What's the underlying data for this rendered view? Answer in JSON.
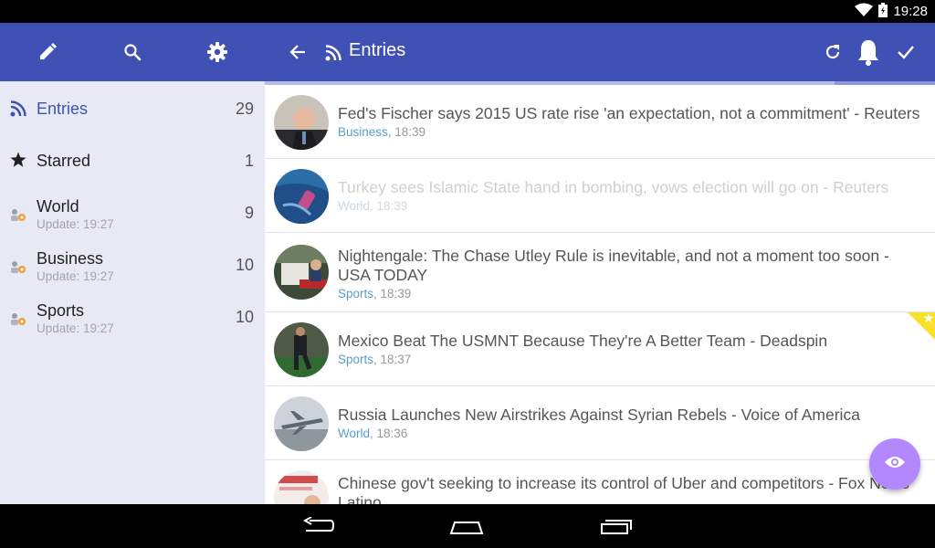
{
  "status_bar": {
    "time": "19:28"
  },
  "sidebar": {
    "toolbar_icons": [
      "edit-icon",
      "search-icon",
      "settings-icon"
    ],
    "items": [
      {
        "name": "Entries",
        "count": "29",
        "sub": "",
        "icon": "rss-icon"
      },
      {
        "name": "Starred",
        "count": "1",
        "sub": "",
        "icon": "star-icon"
      },
      {
        "name": "World",
        "count": "9",
        "sub": "Update: 19:27",
        "icon": "feed-icon"
      },
      {
        "name": "Business",
        "count": "10",
        "sub": "Update: 19:27",
        "icon": "feed-icon"
      },
      {
        "name": "Sports",
        "count": "10",
        "sub": "Update: 19:27",
        "icon": "feed-icon"
      }
    ]
  },
  "toolbar": {
    "title": "Entries",
    "icons": [
      "back-arrow-icon",
      "rss-icon",
      "refresh-icon",
      "notifications-icon",
      "mark-read-icon"
    ],
    "progress": 0.85
  },
  "entries": [
    {
      "title": "Fed's Fischer says 2015 US rate rise 'an expectation, not a commitment' - Reuters",
      "category": "Business",
      "time": ", 18:39",
      "read": false,
      "starred": false
    },
    {
      "title": "Turkey sees Islamic State hand in bombing, vows election will go on - Reuters",
      "category": "World",
      "time": ", 18:39",
      "read": true,
      "starred": false
    },
    {
      "title": "Nightengale: The Chase Utley Rule is inevitable, and not a moment too soon - USA TODAY",
      "category": "Sports",
      "time": ", 18:39",
      "read": false,
      "starred": false
    },
    {
      "title": "Mexico Beat The USMNT Because They're A Better Team - Deadspin",
      "category": "Sports",
      "time": ", 18:37",
      "read": false,
      "starred": true
    },
    {
      "title": "Russia Launches New Airstrikes Against Syrian Rebels - Voice of America",
      "category": "World",
      "time": ", 18:36",
      "read": false,
      "starred": false
    },
    {
      "title": "Chinese gov't seeking to increase its control of Uber and competitors - Fox News Latino",
      "category": "",
      "time": "",
      "read": false,
      "starred": false
    }
  ],
  "fab": {
    "icon": "eye-icon"
  },
  "nav_bar": {
    "icons": [
      "nav-back-icon",
      "nav-home-icon",
      "nav-recents-icon"
    ]
  },
  "colors": {
    "primary": "#3f51b5",
    "accent": "#b388ff",
    "category": "#5a9ecf",
    "star": "#f7e12b"
  }
}
